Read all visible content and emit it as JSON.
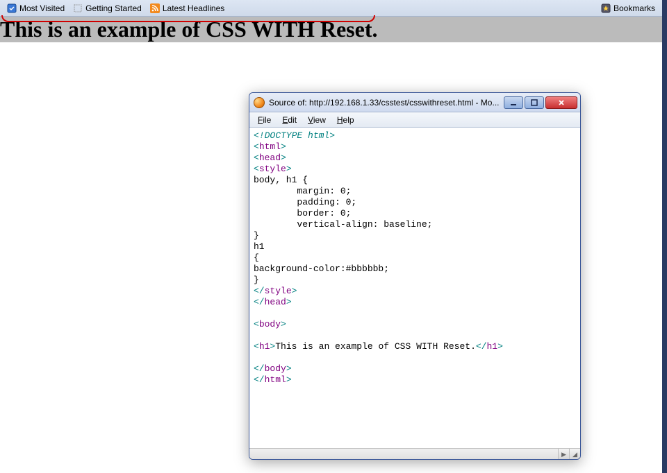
{
  "bookmarks_bar": {
    "items": [
      {
        "label": "Most Visited",
        "icon": "most-visited-icon"
      },
      {
        "label": "Getting Started",
        "icon": "dotted-page-icon"
      },
      {
        "label": "Latest Headlines",
        "icon": "rss-icon"
      }
    ],
    "right": {
      "label": "Bookmarks",
      "icon": "bookmarks-icon"
    }
  },
  "page": {
    "heading": "This is an example of CSS WITH Reset."
  },
  "source_window": {
    "title": "Source of: http://192.168.1.33/csstest/csswithreset.html - Mo...",
    "menus": {
      "file": "File",
      "edit": "Edit",
      "view": "View",
      "help": "Help"
    },
    "code": {
      "l1_doctype": "<!DOCTYPE html>",
      "l2_html_open": "html",
      "l3_head_open": "head",
      "l4_style_open": "style",
      "l5": "body, h1 {",
      "l6": "        margin: 0;",
      "l7": "        padding: 0;",
      "l8": "        border: 0;",
      "l9": "        vertical-align: baseline;",
      "l10": "}",
      "l11": "h1",
      "l12": "{",
      "l13": "background-color:#bbbbbb;",
      "l14": "}",
      "l15_style_close": "style",
      "l16_head_close": "head",
      "l17_blank": "",
      "l18_body_open": "body",
      "l19_blank": "",
      "l20_h1_open": "h1",
      "l20_text": "This is an example of CSS WITH Reset.",
      "l20_h1_close": "h1",
      "l21_blank": "",
      "l22_body_close": "body",
      "l23_html_close": "html"
    }
  }
}
